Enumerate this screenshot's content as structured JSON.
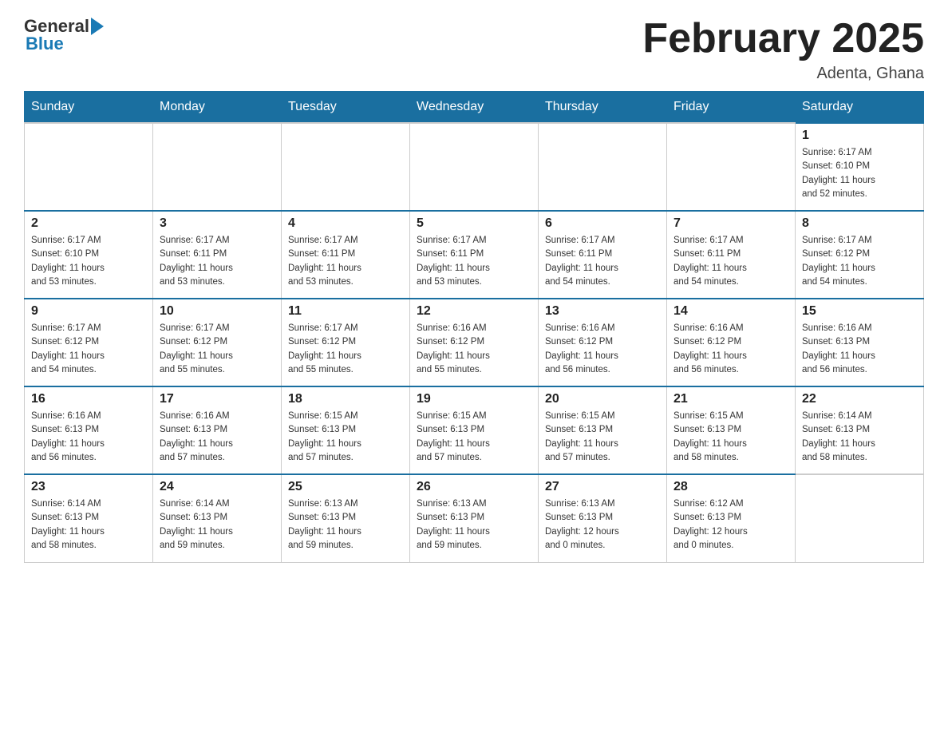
{
  "header": {
    "logo_general": "General",
    "logo_blue": "Blue",
    "month_title": "February 2025",
    "location": "Adenta, Ghana"
  },
  "weekdays": [
    "Sunday",
    "Monday",
    "Tuesday",
    "Wednesday",
    "Thursday",
    "Friday",
    "Saturday"
  ],
  "weeks": [
    [
      {
        "day": "",
        "info": ""
      },
      {
        "day": "",
        "info": ""
      },
      {
        "day": "",
        "info": ""
      },
      {
        "day": "",
        "info": ""
      },
      {
        "day": "",
        "info": ""
      },
      {
        "day": "",
        "info": ""
      },
      {
        "day": "1",
        "info": "Sunrise: 6:17 AM\nSunset: 6:10 PM\nDaylight: 11 hours\nand 52 minutes."
      }
    ],
    [
      {
        "day": "2",
        "info": "Sunrise: 6:17 AM\nSunset: 6:10 PM\nDaylight: 11 hours\nand 53 minutes."
      },
      {
        "day": "3",
        "info": "Sunrise: 6:17 AM\nSunset: 6:11 PM\nDaylight: 11 hours\nand 53 minutes."
      },
      {
        "day": "4",
        "info": "Sunrise: 6:17 AM\nSunset: 6:11 PM\nDaylight: 11 hours\nand 53 minutes."
      },
      {
        "day": "5",
        "info": "Sunrise: 6:17 AM\nSunset: 6:11 PM\nDaylight: 11 hours\nand 53 minutes."
      },
      {
        "day": "6",
        "info": "Sunrise: 6:17 AM\nSunset: 6:11 PM\nDaylight: 11 hours\nand 54 minutes."
      },
      {
        "day": "7",
        "info": "Sunrise: 6:17 AM\nSunset: 6:11 PM\nDaylight: 11 hours\nand 54 minutes."
      },
      {
        "day": "8",
        "info": "Sunrise: 6:17 AM\nSunset: 6:12 PM\nDaylight: 11 hours\nand 54 minutes."
      }
    ],
    [
      {
        "day": "9",
        "info": "Sunrise: 6:17 AM\nSunset: 6:12 PM\nDaylight: 11 hours\nand 54 minutes."
      },
      {
        "day": "10",
        "info": "Sunrise: 6:17 AM\nSunset: 6:12 PM\nDaylight: 11 hours\nand 55 minutes."
      },
      {
        "day": "11",
        "info": "Sunrise: 6:17 AM\nSunset: 6:12 PM\nDaylight: 11 hours\nand 55 minutes."
      },
      {
        "day": "12",
        "info": "Sunrise: 6:16 AM\nSunset: 6:12 PM\nDaylight: 11 hours\nand 55 minutes."
      },
      {
        "day": "13",
        "info": "Sunrise: 6:16 AM\nSunset: 6:12 PM\nDaylight: 11 hours\nand 56 minutes."
      },
      {
        "day": "14",
        "info": "Sunrise: 6:16 AM\nSunset: 6:12 PM\nDaylight: 11 hours\nand 56 minutes."
      },
      {
        "day": "15",
        "info": "Sunrise: 6:16 AM\nSunset: 6:13 PM\nDaylight: 11 hours\nand 56 minutes."
      }
    ],
    [
      {
        "day": "16",
        "info": "Sunrise: 6:16 AM\nSunset: 6:13 PM\nDaylight: 11 hours\nand 56 minutes."
      },
      {
        "day": "17",
        "info": "Sunrise: 6:16 AM\nSunset: 6:13 PM\nDaylight: 11 hours\nand 57 minutes."
      },
      {
        "day": "18",
        "info": "Sunrise: 6:15 AM\nSunset: 6:13 PM\nDaylight: 11 hours\nand 57 minutes."
      },
      {
        "day": "19",
        "info": "Sunrise: 6:15 AM\nSunset: 6:13 PM\nDaylight: 11 hours\nand 57 minutes."
      },
      {
        "day": "20",
        "info": "Sunrise: 6:15 AM\nSunset: 6:13 PM\nDaylight: 11 hours\nand 57 minutes."
      },
      {
        "day": "21",
        "info": "Sunrise: 6:15 AM\nSunset: 6:13 PM\nDaylight: 11 hours\nand 58 minutes."
      },
      {
        "day": "22",
        "info": "Sunrise: 6:14 AM\nSunset: 6:13 PM\nDaylight: 11 hours\nand 58 minutes."
      }
    ],
    [
      {
        "day": "23",
        "info": "Sunrise: 6:14 AM\nSunset: 6:13 PM\nDaylight: 11 hours\nand 58 minutes."
      },
      {
        "day": "24",
        "info": "Sunrise: 6:14 AM\nSunset: 6:13 PM\nDaylight: 11 hours\nand 59 minutes."
      },
      {
        "day": "25",
        "info": "Sunrise: 6:13 AM\nSunset: 6:13 PM\nDaylight: 11 hours\nand 59 minutes."
      },
      {
        "day": "26",
        "info": "Sunrise: 6:13 AM\nSunset: 6:13 PM\nDaylight: 11 hours\nand 59 minutes."
      },
      {
        "day": "27",
        "info": "Sunrise: 6:13 AM\nSunset: 6:13 PM\nDaylight: 12 hours\nand 0 minutes."
      },
      {
        "day": "28",
        "info": "Sunrise: 6:12 AM\nSunset: 6:13 PM\nDaylight: 12 hours\nand 0 minutes."
      },
      {
        "day": "",
        "info": ""
      }
    ]
  ]
}
